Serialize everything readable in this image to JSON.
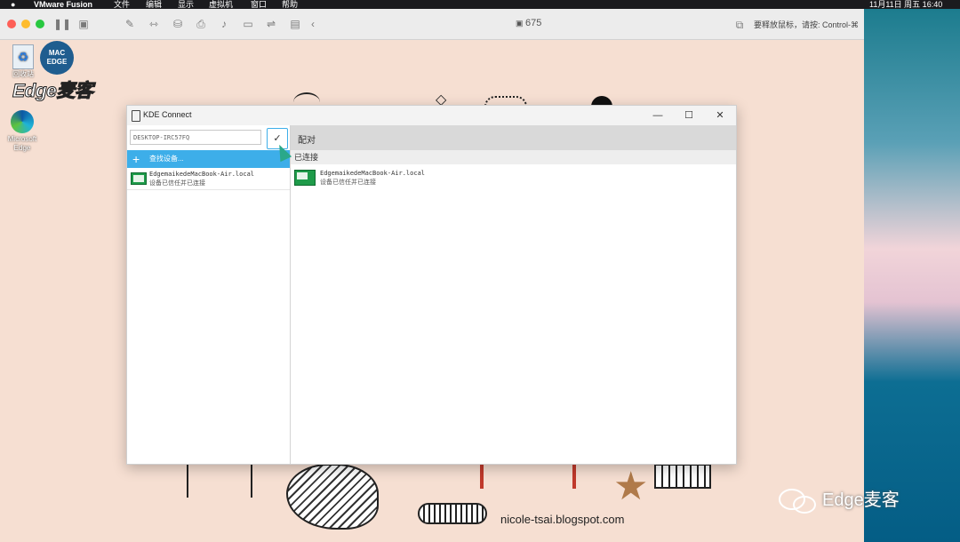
{
  "menubar": {
    "app": "VMware Fusion",
    "items": [
      "文件",
      "编辑",
      "显示",
      "虚拟机",
      "窗口",
      "帮助"
    ],
    "clock": "11月11日 周五  16:40"
  },
  "vm_window": {
    "title": "675",
    "hint": "要释放鼠标，请按: Control-⌘"
  },
  "desktop": {
    "icons": [
      {
        "label": "回收站"
      },
      {
        "label": "Microsoft\nEdge"
      }
    ],
    "brand": "Edge麦客",
    "logo_text": "MAC EDGE"
  },
  "kde": {
    "title": "KDE Connect",
    "device_name_value": "DESKTOP-IRC57FQ",
    "find_devices": "查找设备...",
    "pair_label": "配对",
    "section_connected": "已连接",
    "devices": [
      {
        "name": "EdgemaikedeMacBook-Air.local",
        "status": "设备已信任并已连接"
      }
    ]
  },
  "credit": "nicole-tsai.blogspot.com",
  "watermark": "Edge麦客",
  "colors": {
    "accent": "#3daee9",
    "device_green": "#1f9b4a",
    "desktop_bg": "#f6dfd2"
  }
}
